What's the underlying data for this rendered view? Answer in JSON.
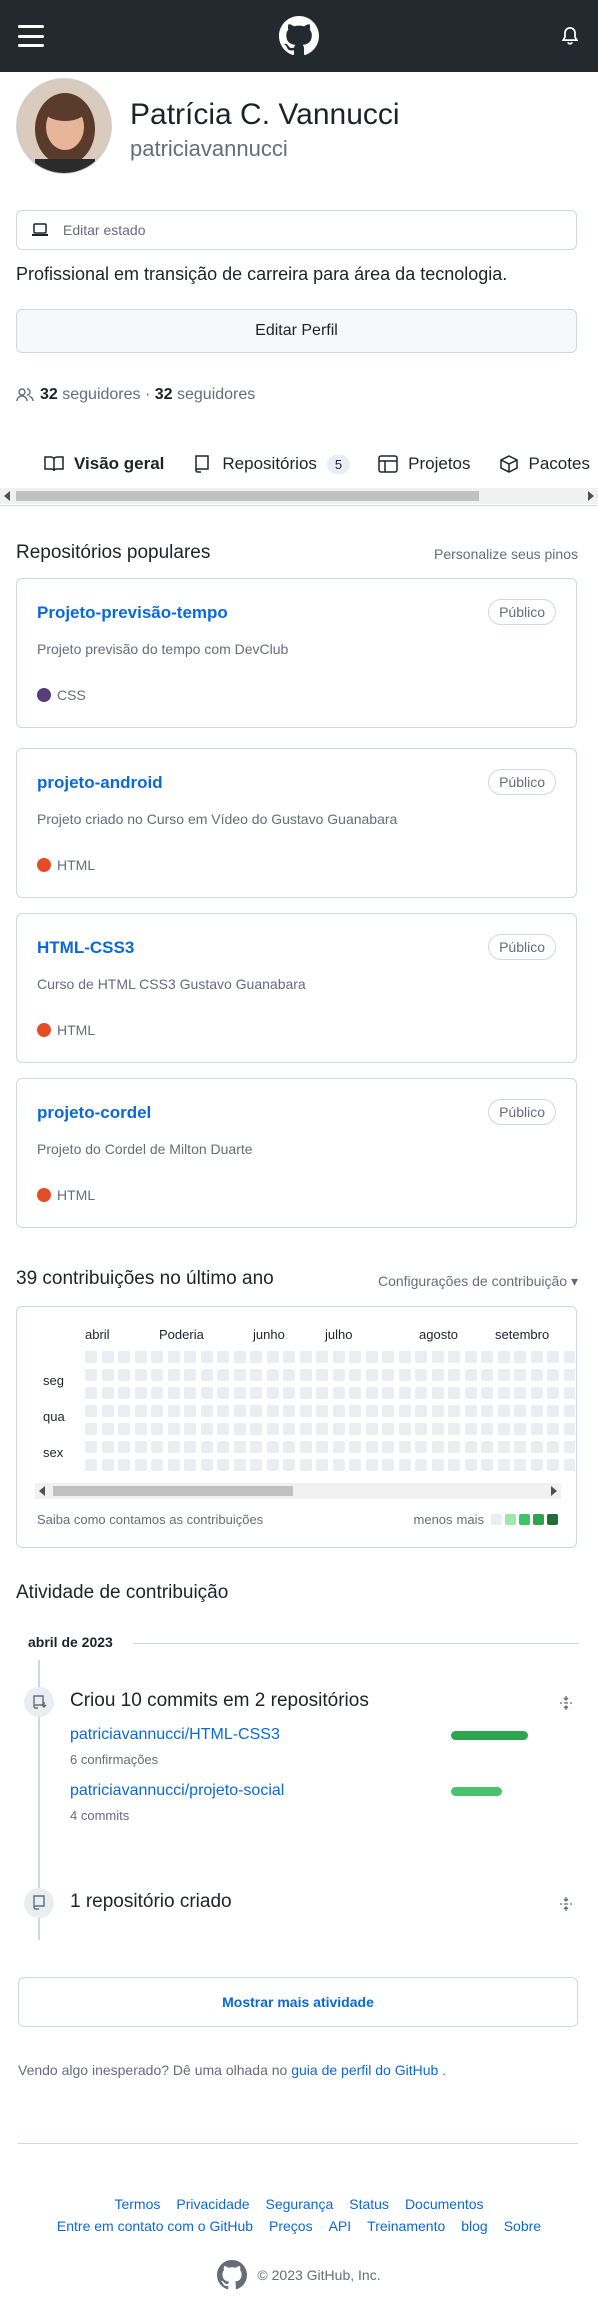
{
  "header": {},
  "profile": {
    "name": "Patrícia C. Vannucci",
    "username": "patriciavannucci",
    "status_label": "Editar estado",
    "bio": "Profissional em transição de carreira para área da tecnologia.",
    "edit_label": "Editar Perfil",
    "followers_count": "32",
    "followers_label": "seguidores",
    "following_count": "32",
    "following_label": "seguidores"
  },
  "tabs": [
    {
      "label": "Visão geral"
    },
    {
      "label": "Repositórios",
      "count": "5"
    },
    {
      "label": "Projetos"
    },
    {
      "label": "Pacotes"
    }
  ],
  "popular": {
    "title": "Repositórios populares",
    "customize": "Personalize seus pinos",
    "repos": [
      {
        "name": "Projeto-previsão-tempo",
        "visibility": "Público",
        "description": "Projeto previsão do tempo com DevClub",
        "language": "CSS",
        "language_color": "#563d7c"
      },
      {
        "name": "projeto-android",
        "visibility": "Público",
        "description": "Projeto criado no Curso em Vídeo do Gustavo Guanabara",
        "language": "HTML",
        "language_color": "#e34c26"
      },
      {
        "name": "HTML-CSS3",
        "visibility": "Público",
        "description": "Curso de HTML CSS3 Gustavo Guanabara",
        "language": "HTML",
        "language_color": "#e34c26"
      },
      {
        "name": "projeto-cordel",
        "visibility": "Público",
        "description": "Projeto do Cordel de Milton Duarte",
        "language": "HTML",
        "language_color": "#e34c26"
      }
    ]
  },
  "contributions": {
    "title": "39 contribuições no último ano",
    "settings": "Configurações de contribuição",
    "months": [
      "abril",
      "Poderia",
      "junho",
      "julho",
      "agosto",
      "setembro"
    ],
    "days": [
      "seg",
      "qua",
      "sex"
    ],
    "learn": "Saiba como contamos as contribuições",
    "legend_less": "menos",
    "legend_more": "mais",
    "legend_colors": [
      "#ebedf0",
      "#9be9a8",
      "#40c463",
      "#30a14e",
      "#216e39"
    ]
  },
  "activity": {
    "title": "Atividade de contribuição",
    "period": "abril de 2023",
    "commits_title": "Criou 10 commits em 2 repositórios",
    "commit_repos": [
      {
        "name": "patriciavannucci/HTML-CSS3",
        "detail": "6 confirmações",
        "share": 0.6,
        "color": "#2da44e"
      },
      {
        "name": "patriciavannucci/projeto-social",
        "detail": "4 commits",
        "share": 0.4,
        "color": "#4ac26b"
      }
    ],
    "created_title": "1 repositório criado",
    "more_label": "Mostrar mais atividade"
  },
  "hint": {
    "text": "Vendo algo inesperado? Dê uma olhada no",
    "link": "guia de perfil do GitHub",
    "end": "."
  },
  "footer": {
    "row1": [
      "Termos",
      "Privacidade",
      "Segurança",
      "Status",
      "Documentos"
    ],
    "row2": [
      "Entre em contato com o GitHub",
      "Preços",
      "API",
      "Treinamento",
      "blog",
      "Sobre"
    ],
    "copyright": "© 2023 GitHub, Inc."
  }
}
